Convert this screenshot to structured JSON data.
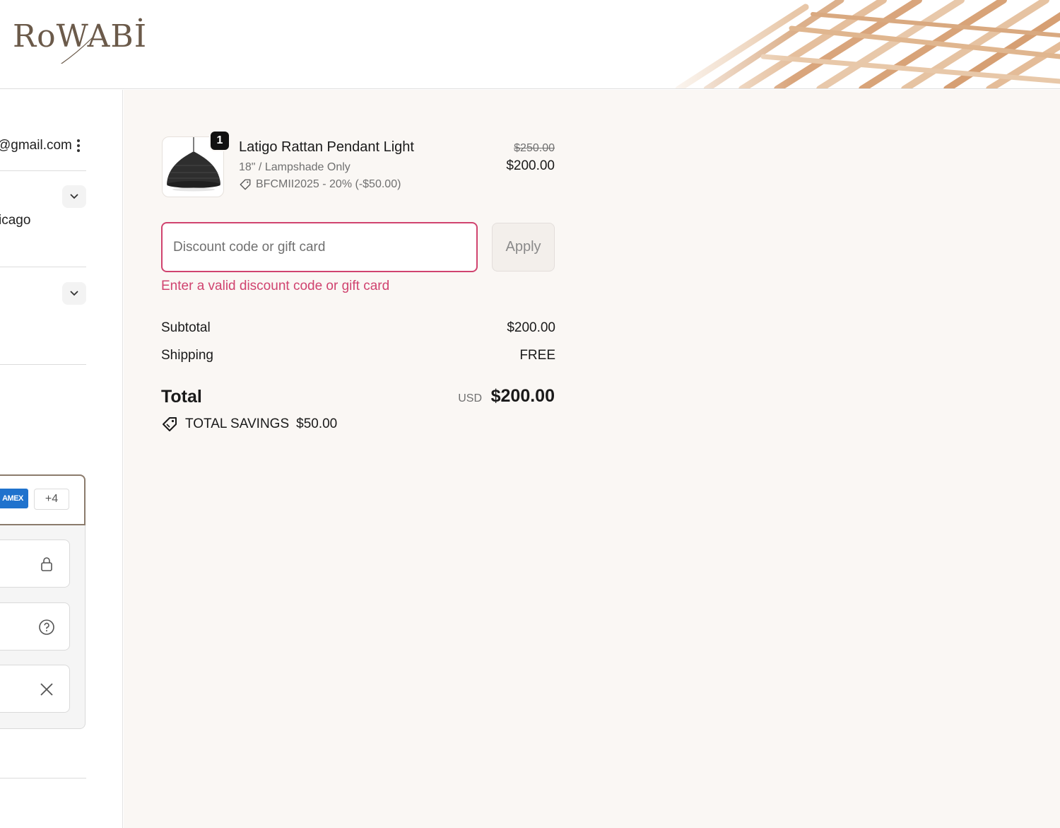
{
  "brand": {
    "logo_text": "RoWABİ"
  },
  "contact": {
    "email_partial": "@gmail.com"
  },
  "shipping": {
    "city_partial": "icago"
  },
  "payment": {
    "card_brand": "AMEX",
    "more_cards": "+4"
  },
  "cart": {
    "quantity": "1",
    "product_name": "Latigo Rattan Pendant Light",
    "variant": "18\" / Lampshade Only",
    "discount_line": "BFCMII2025 - 20% (-$50.00)",
    "original_price": "$250.00",
    "price": "$200.00"
  },
  "discount": {
    "placeholder": "Discount code or gift card",
    "apply_label": "Apply",
    "error": "Enter a valid discount code or gift card"
  },
  "totals": {
    "subtotal_label": "Subtotal",
    "subtotal_value": "$200.00",
    "shipping_label": "Shipping",
    "shipping_value": "FREE",
    "total_label": "Total",
    "currency": "USD",
    "total_value": "$200.00",
    "savings_label": "TOTAL SAVINGS",
    "savings_value": "$50.00"
  },
  "colors": {
    "error": "#d0436f",
    "summary_bg": "#faf7f4",
    "amex": "#1f72cd"
  }
}
